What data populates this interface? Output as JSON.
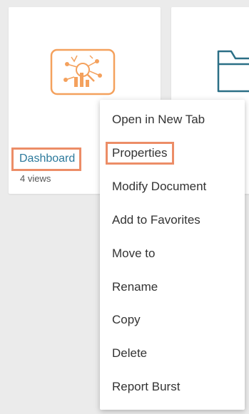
{
  "cards": [
    {
      "label": "Dashboard",
      "views": "4 views"
    }
  ],
  "colors": {
    "accent_orange": "#f4a15d",
    "highlight_box": "#ec8d67",
    "link_blue": "#2d7a9c",
    "folder_teal": "#2b6f86"
  },
  "icons": {
    "dashboard": "dashboard-analytics-icon",
    "folder": "folder-icon"
  },
  "context_menu": {
    "items": [
      "Open in New Tab",
      "Properties",
      "Modify Document",
      "Add to Favorites",
      "Move to",
      "Rename",
      "Copy",
      "Delete",
      "Report Burst"
    ]
  }
}
